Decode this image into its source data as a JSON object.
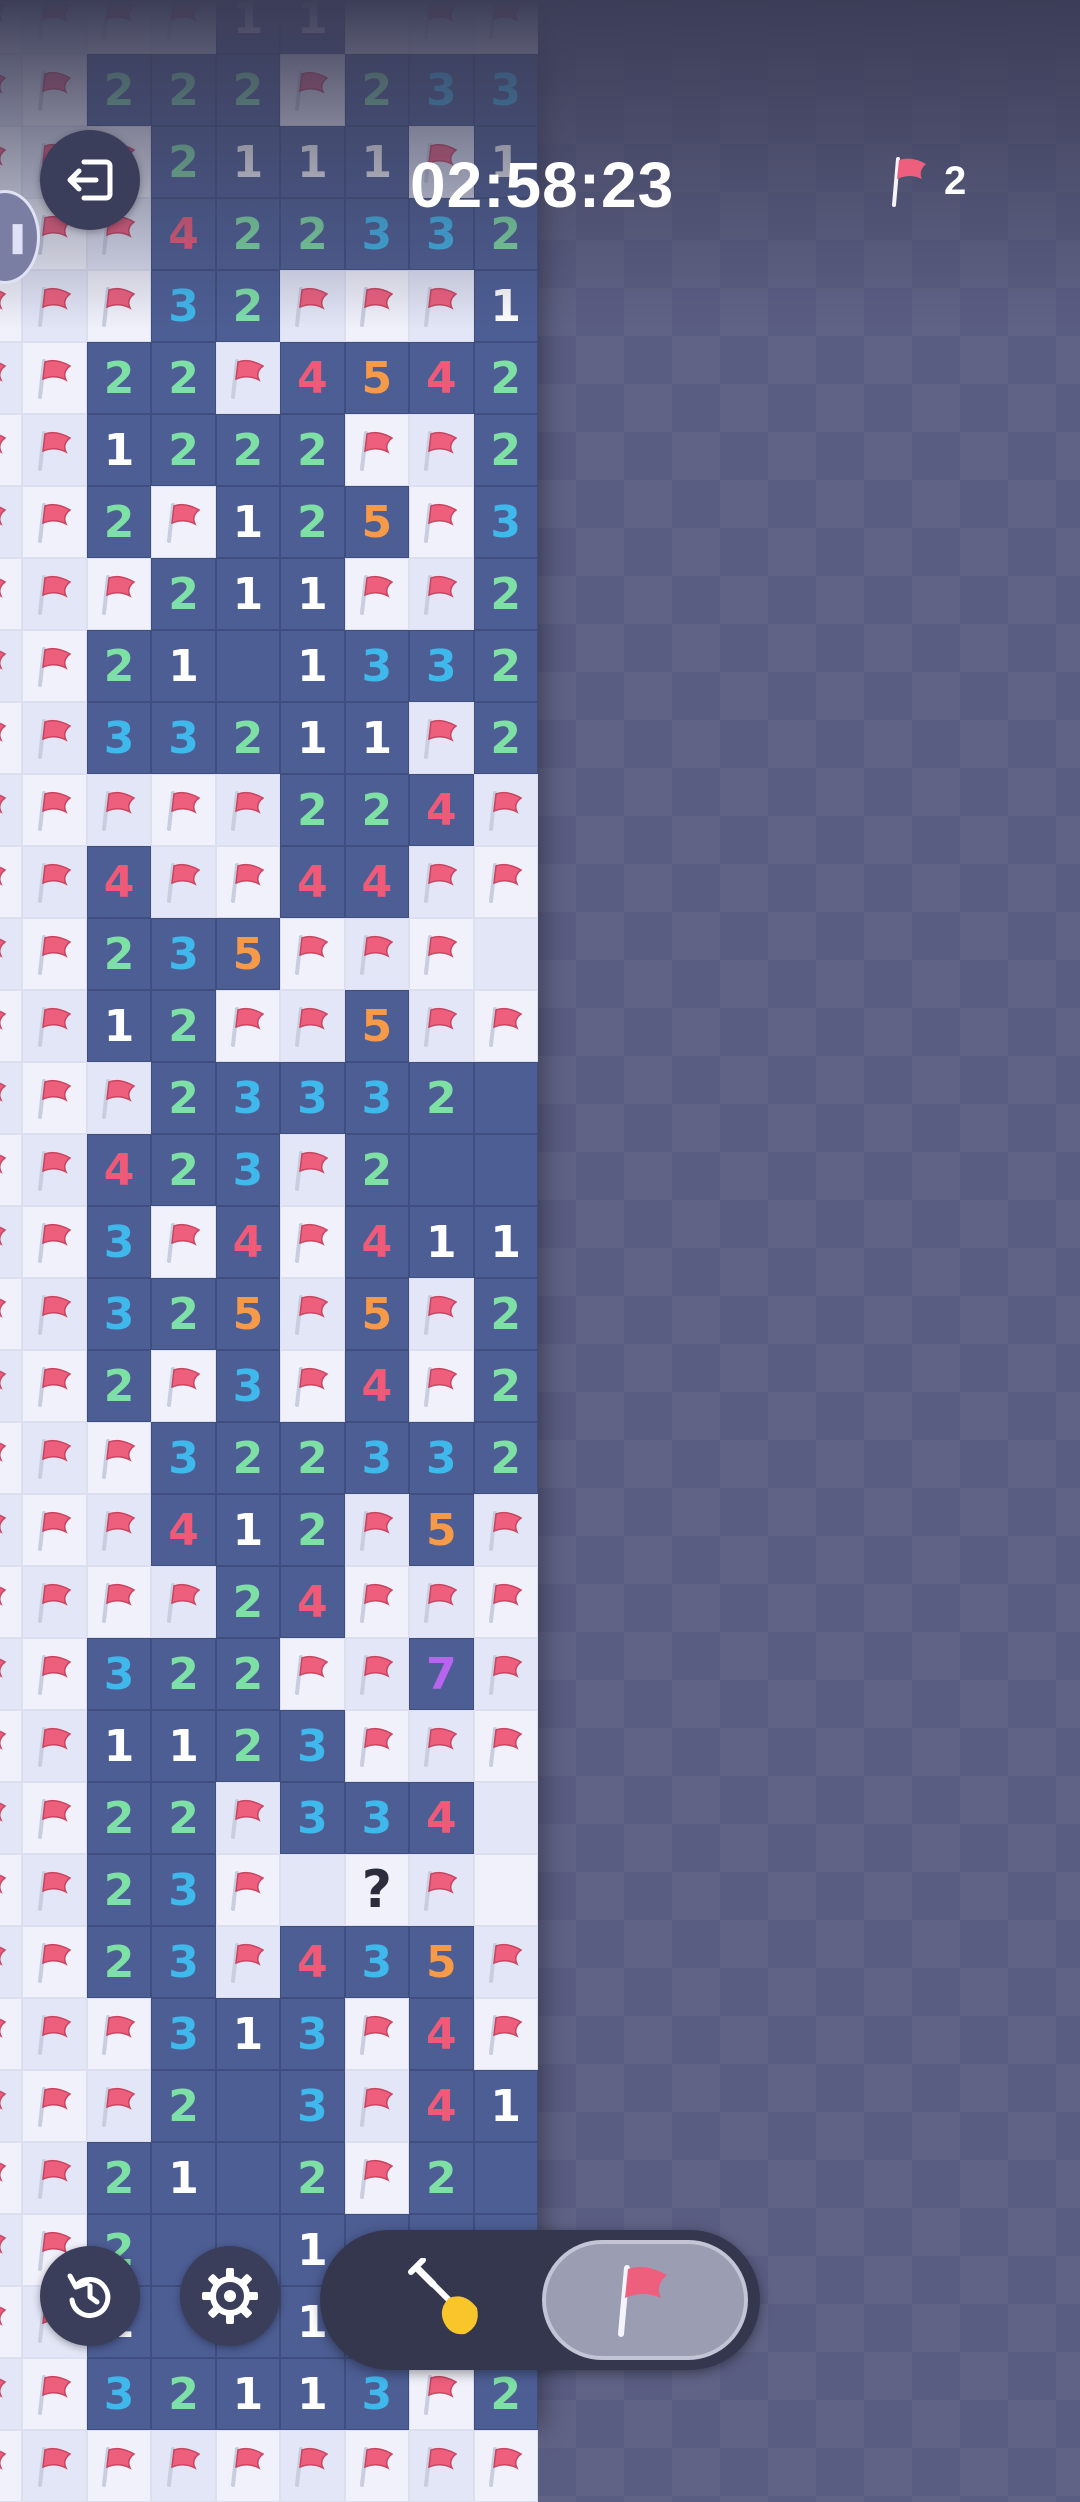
{
  "hud": {
    "timer": "02:58:23",
    "flag_count": "2"
  },
  "controls": {
    "exit_icon": "exit-icon",
    "pause_icon": "pause-icon",
    "restart_icon": "restart-icon",
    "settings_icon": "gear-icon",
    "dig_mode_icon": "shovel-icon",
    "flag_mode_icon": "flag-icon",
    "active_mode": "flag"
  },
  "colors": {
    "1": "#ffffff",
    "2": "#7fe0a6",
    "3": "#3fb8ec",
    "4": "#ee5a78",
    "5": "#f59a48",
    "7": "#b765ee",
    "flag": "#ee5f7e"
  },
  "board": {
    "legend": "digits = revealed count, F = flag, C = covered, ? = question mark, . = empty revealed",
    "rows": [
      "FFFF11CFF",
      "FF222F233",
      "FFF2111F1",
      "FFF422332",
      "FFF32FFF1",
      "FF22F4542",
      "FF1222FF2",
      "FF2F125F3",
      "FFF211FF2",
      "FF21.1332",
      "FF33211F2",
      "FFFFF224F",
      "FF4FF44FF",
      "FF235FFFC",
      "FF12FF5FF",
      "FFF23332.",
      "FF423F2..",
      "FF3F4F411",
      "FF325F5F2",
      "FF2F3F4F2",
      "FFF322332",
      "FFF412F5F",
      "FFFF24FFF",
      "FF322FF7F",
      "FF1123FFF",
      "FF22F334C",
      "FF23FC?FC",
      "FF23F435F",
      "FFF313F4F",
      "FFF2.3F41",
      "FF21.2F2.",
      "FF2..1...",
      "FF1..1...",
      "FF32113F2",
      "FFFFFFFFF"
    ]
  }
}
